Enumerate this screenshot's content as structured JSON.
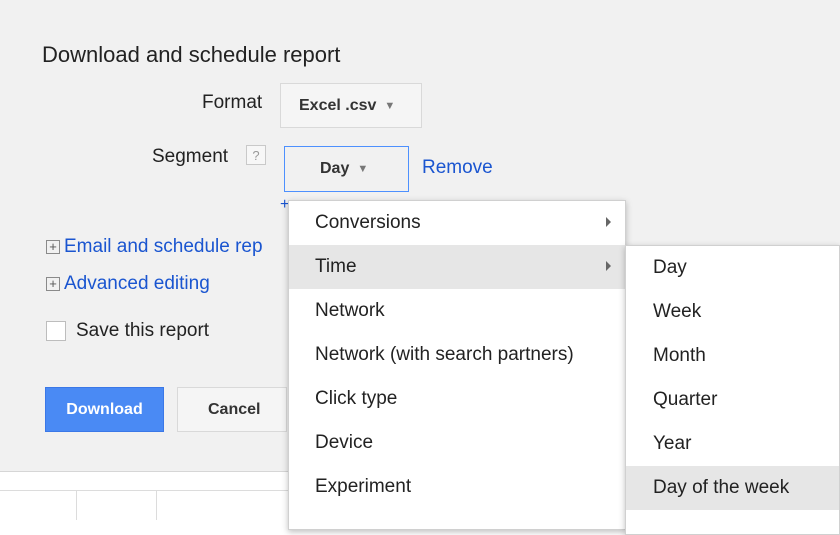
{
  "dialog": {
    "title": "Download and schedule report",
    "format_label": "Format",
    "format_value": "Excel .csv",
    "segment_label": "Segment",
    "help_glyph": "?",
    "segment_value": "Day",
    "remove_link": "Remove",
    "plus_glyph": "+",
    "email_schedule_link": "Email and schedule rep",
    "advanced_link": "Advanced editing",
    "expand_glyph": "+",
    "save_label": "Save this report",
    "download_button": "Download",
    "cancel_button": "Cancel"
  },
  "segment_menu": {
    "items": [
      {
        "label": "Conversions",
        "has_submenu": true
      },
      {
        "label": "Time",
        "has_submenu": true,
        "highlighted": true
      },
      {
        "label": "Network"
      },
      {
        "label": "Network (with search partners)"
      },
      {
        "label": "Click type"
      },
      {
        "label": "Device"
      },
      {
        "label": "Experiment"
      }
    ]
  },
  "time_submenu": {
    "items": [
      {
        "label": "Day"
      },
      {
        "label": "Week"
      },
      {
        "label": "Month"
      },
      {
        "label": "Quarter"
      },
      {
        "label": "Year"
      },
      {
        "label": "Day of the week",
        "highlighted": true
      }
    ]
  },
  "colors": {
    "primary_blue": "#4a8af4",
    "link_blue": "#1a55d0",
    "panel_bg": "#f1f1f1",
    "focus_border": "#4d90fe"
  }
}
